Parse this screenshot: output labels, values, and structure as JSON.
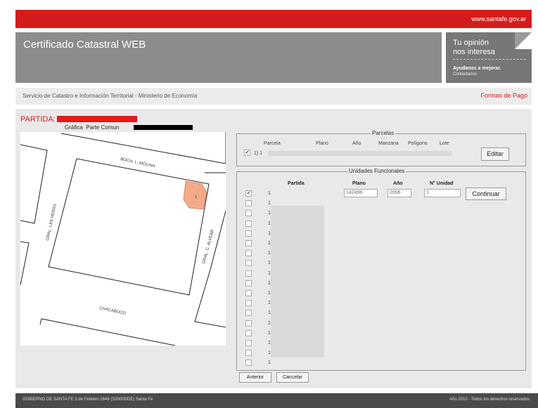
{
  "top_bar": {
    "site_url": "www.santafe.gov.ar"
  },
  "header": {
    "title": "Certificado Catastral WEB"
  },
  "opinion": {
    "line1": "Tu opinión",
    "line2": "nos interesa",
    "line3": "Ayudanos a mejorar.",
    "line4": "Contactanos"
  },
  "subbar": {
    "service": "Servicio de Catastro e Información Territorial - Ministerio de Economía",
    "payment": "Formas de Pago"
  },
  "partida": {
    "label": "PARTIDA:",
    "grafica": "Gráfica",
    "parte_comun": "Parte Comun"
  },
  "map": {
    "streets": [
      "BOCH. L. MOLINA",
      "GRAL. LAS HERAS",
      "GRAL. C. ALVEAR",
      "CHACABUCO"
    ],
    "parcel_number": "1"
  },
  "parcelas": {
    "legend": "Parcelas",
    "columns": [
      "Parcela",
      "Plano",
      "Año",
      "Manzana",
      "Polígono",
      "Lote"
    ],
    "row_prefix": "1) 1",
    "edit_label": "Editar"
  },
  "unidades": {
    "legend": "Unidades Funcionales",
    "columns": {
      "partida": "Partida",
      "plano": "Plano",
      "anio": "Año",
      "unidad": "N° Unidad"
    },
    "first_row": {
      "plano": "142496",
      "anio": "2006",
      "unidad": "1"
    },
    "continue_label": "Continuar",
    "row_prefix": "1",
    "row_count": 18
  },
  "actions": {
    "back_label": "Anterior",
    "cancel_label": "Cancelar"
  },
  "footer": {
    "left": "GOBIERNO DE SANTA FE 3 de Febrero 2649 (S3000DDE) Santa Fe",
    "right": "Año 2010 - Todos los derechos reservados"
  },
  "colors": {
    "brand_red": "#d51c1c",
    "header_gray": "#8c8c8c",
    "parcel_fill": "#f4a98a"
  }
}
